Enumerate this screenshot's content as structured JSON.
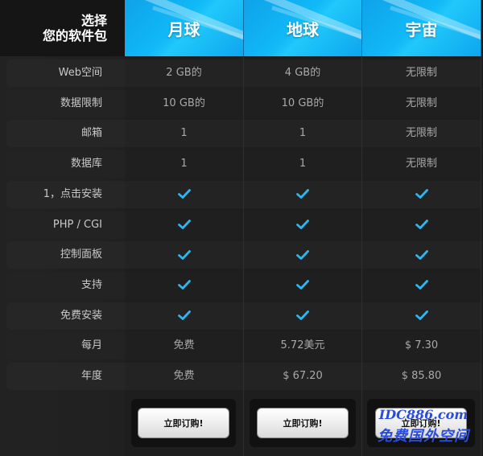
{
  "header": {
    "corner_line1": "选择",
    "corner_line2": "您的软件包",
    "plans": [
      "月球",
      "地球",
      "宇宙"
    ]
  },
  "rows": [
    {
      "label": "Web空间",
      "values": [
        "2 GB的",
        "4 GB的",
        "无限制"
      ]
    },
    {
      "label": "数据限制",
      "values": [
        "10 GB的",
        "10 GB的",
        "无限制"
      ]
    },
    {
      "label": "邮箱",
      "values": [
        "1",
        "1",
        "无限制"
      ]
    },
    {
      "label": "数据库",
      "values": [
        "1",
        "1",
        "无限制"
      ]
    },
    {
      "label": "1，点击安装",
      "values": [
        "check",
        "check",
        "check"
      ]
    },
    {
      "label": "PHP / CGI",
      "values": [
        "check",
        "check",
        "check"
      ]
    },
    {
      "label": "控制面板",
      "values": [
        "check",
        "check",
        "check"
      ]
    },
    {
      "label": "支持",
      "values": [
        "check",
        "check",
        "check"
      ]
    },
    {
      "label": "免费安装",
      "values": [
        "check",
        "check",
        "check"
      ]
    },
    {
      "label": "每月",
      "values": [
        "免费",
        "5.72美元",
        "$ 7.30"
      ]
    },
    {
      "label": "年度",
      "values": [
        "免费",
        "$ 67.20",
        "$ 85.80"
      ]
    }
  ],
  "buttons": {
    "order_label": "立即订购!"
  },
  "watermark": {
    "line1": "IDC886.com",
    "line2": "免费国外空间"
  },
  "colors": {
    "accent": "#12b4f5",
    "check": "#2bb8f0"
  }
}
